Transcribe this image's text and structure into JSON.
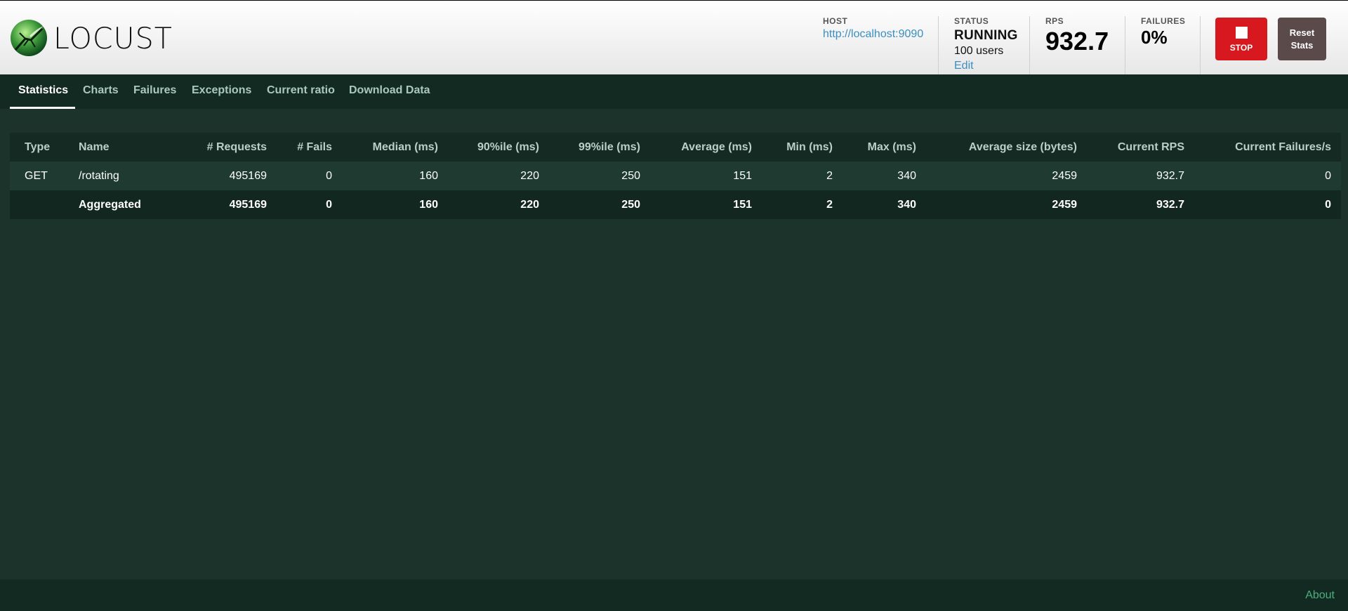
{
  "app": {
    "name": "LOCUST"
  },
  "header": {
    "host_label": "HOST",
    "host_value": "http://localhost:9090",
    "status_label": "STATUS",
    "status_value": "RUNNING",
    "users_value": "100 users",
    "edit_label": "Edit",
    "rps_label": "RPS",
    "rps_value": "932.7",
    "failures_label": "FAILURES",
    "failures_value": "0%",
    "stop_label": "STOP",
    "reset_line1": "Reset",
    "reset_line2": "Stats"
  },
  "tabs": [
    {
      "label": "Statistics",
      "active": true
    },
    {
      "label": "Charts"
    },
    {
      "label": "Failures"
    },
    {
      "label": "Exceptions"
    },
    {
      "label": "Current ratio"
    },
    {
      "label": "Download Data"
    }
  ],
  "table": {
    "columns": [
      "Type",
      "Name",
      "# Requests",
      "# Fails",
      "Median (ms)",
      "90%ile (ms)",
      "99%ile (ms)",
      "Average (ms)",
      "Min (ms)",
      "Max (ms)",
      "Average size (bytes)",
      "Current RPS",
      "Current Failures/s"
    ],
    "rows": [
      [
        "GET",
        "/rotating",
        "495169",
        "0",
        "160",
        "220",
        "250",
        "151",
        "2",
        "340",
        "2459",
        "932.7",
        "0"
      ]
    ],
    "aggregated": [
      "",
      "Aggregated",
      "495169",
      "0",
      "160",
      "220",
      "250",
      "151",
      "2",
      "340",
      "2459",
      "932.7",
      "0"
    ]
  },
  "footer": {
    "about_label": "About"
  },
  "colors": {
    "background": "#1b332b",
    "stop_button": "#d7191f",
    "reset_button": "#5a4a49",
    "link": "#3a8fc0",
    "about_link": "#4caf7d"
  },
  "icons": {
    "logo": "locust-logo-icon",
    "stop": "stop-square-icon"
  }
}
